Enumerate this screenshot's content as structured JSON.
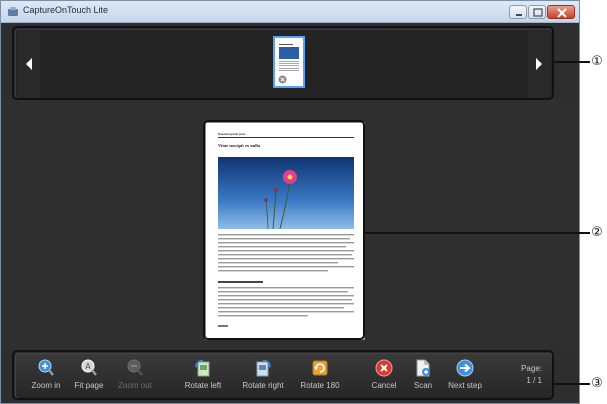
{
  "window": {
    "title": "CaptureOnTouch Lite"
  },
  "toolbar": {
    "zoom_in": "Zoom in",
    "fit_page": "Fit page",
    "zoom_out": "Zoom out",
    "rotate_left": "Rotate left",
    "rotate_right": "Rotate right",
    "rotate_180": "Rotate 180",
    "cancel": "Cancel",
    "scan": "Scan",
    "next_step": "Next step",
    "page_label": "Page:",
    "page_value": "1 / 1"
  },
  "document": {
    "heading": "Donatem ipsum justo",
    "title": "Vitae suscipit ex nulla"
  },
  "callouts": [
    "①",
    "②",
    "③"
  ],
  "icons": {
    "zoom_in": "zoom-in-icon",
    "fit_page": "fit-page-icon",
    "zoom_out": "zoom-out-icon",
    "rotate_left": "rotate-left-icon",
    "rotate_right": "rotate-right-icon",
    "rotate_180": "rotate-180-icon",
    "cancel": "cancel-icon",
    "scan": "scan-icon",
    "next_step": "next-step-icon"
  },
  "colors": {
    "accent_blue": "#3f8fe0",
    "cancel_red": "#d83a2e",
    "selection_blue": "#5aa0ff"
  }
}
